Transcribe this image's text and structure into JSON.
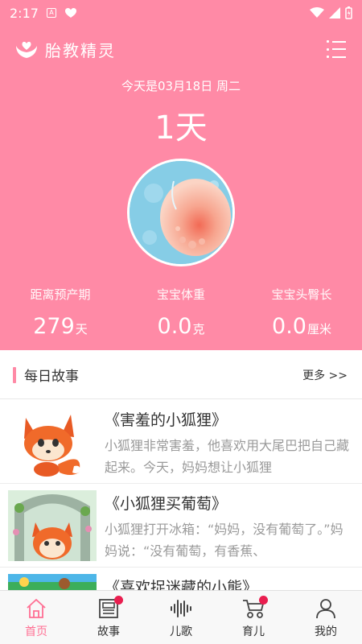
{
  "status_bar": {
    "time": "2:17"
  },
  "app": {
    "title": "胎教精灵"
  },
  "summary": {
    "date_text": "今天是03月18日 周二",
    "days_text": "1天",
    "stats": [
      {
        "label": "距离预产期",
        "value": "279",
        "unit": "天"
      },
      {
        "label": "宝宝体重",
        "value": "0.0",
        "unit": "克"
      },
      {
        "label": "宝宝头臀长",
        "value": "0.0",
        "unit": "厘米"
      }
    ]
  },
  "daily_story": {
    "heading": "每日故事",
    "more": "更多 >>",
    "items": [
      {
        "title": "《害羞的小狐狸》",
        "desc": "小狐狸非常害羞，他喜欢用大尾巴把自己藏起来。今天，妈妈想让小狐狸"
      },
      {
        "title": "《小狐狸买葡萄》",
        "desc": "小狐狸打开冰箱：“妈妈，没有葡萄了。”妈妈说：“没有葡萄，有香蕉、"
      },
      {
        "title": "《喜欢捉迷藏的小熊》",
        "desc": ""
      }
    ]
  },
  "tabs": [
    {
      "label": "首页",
      "icon": "home-icon",
      "active": true,
      "badge": false
    },
    {
      "label": "故事",
      "icon": "newspaper-icon",
      "active": false,
      "badge": true
    },
    {
      "label": "儿歌",
      "icon": "sound-wave-icon",
      "active": false,
      "badge": false
    },
    {
      "label": "育儿",
      "icon": "stroller-icon",
      "active": false,
      "badge": true
    },
    {
      "label": "我的",
      "icon": "person-icon",
      "active": false,
      "badge": false
    }
  ],
  "colors": {
    "primary": "#ff8aa6",
    "active_tab": "#ff6f93",
    "badge": "#e91e4f"
  }
}
